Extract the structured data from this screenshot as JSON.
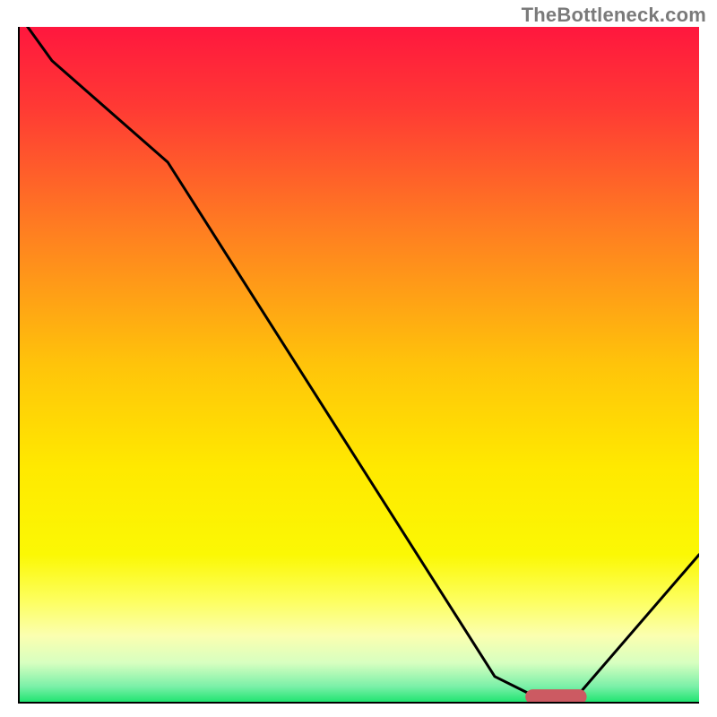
{
  "watermark": "TheBottleneck.com",
  "chart_data": {
    "type": "line",
    "title": "",
    "xlabel": "",
    "ylabel": "",
    "xlim": [
      0,
      100
    ],
    "ylim": [
      0,
      100
    ],
    "grid": false,
    "x": [
      0,
      5,
      22,
      70,
      76,
      82,
      100
    ],
    "values": [
      102,
      95,
      80,
      4,
      1,
      1,
      22
    ],
    "marker": {
      "shape": "rounded-bar",
      "color": "#cc5a62",
      "x_center": 79,
      "y": 1,
      "width": 9,
      "height": 2.2
    },
    "gradient_stops": [
      {
        "offset": 0.0,
        "color": "#ff173e"
      },
      {
        "offset": 0.12,
        "color": "#ff3a34"
      },
      {
        "offset": 0.3,
        "color": "#ff7e21"
      },
      {
        "offset": 0.5,
        "color": "#ffc40a"
      },
      {
        "offset": 0.65,
        "color": "#ffe900"
      },
      {
        "offset": 0.78,
        "color": "#fbf804"
      },
      {
        "offset": 0.85,
        "color": "#fdff62"
      },
      {
        "offset": 0.9,
        "color": "#fbffb0"
      },
      {
        "offset": 0.94,
        "color": "#d7ffc0"
      },
      {
        "offset": 0.975,
        "color": "#7af0a8"
      },
      {
        "offset": 1.0,
        "color": "#17e36b"
      }
    ],
    "axis": {
      "stroke": "#000000",
      "width": 4
    }
  }
}
